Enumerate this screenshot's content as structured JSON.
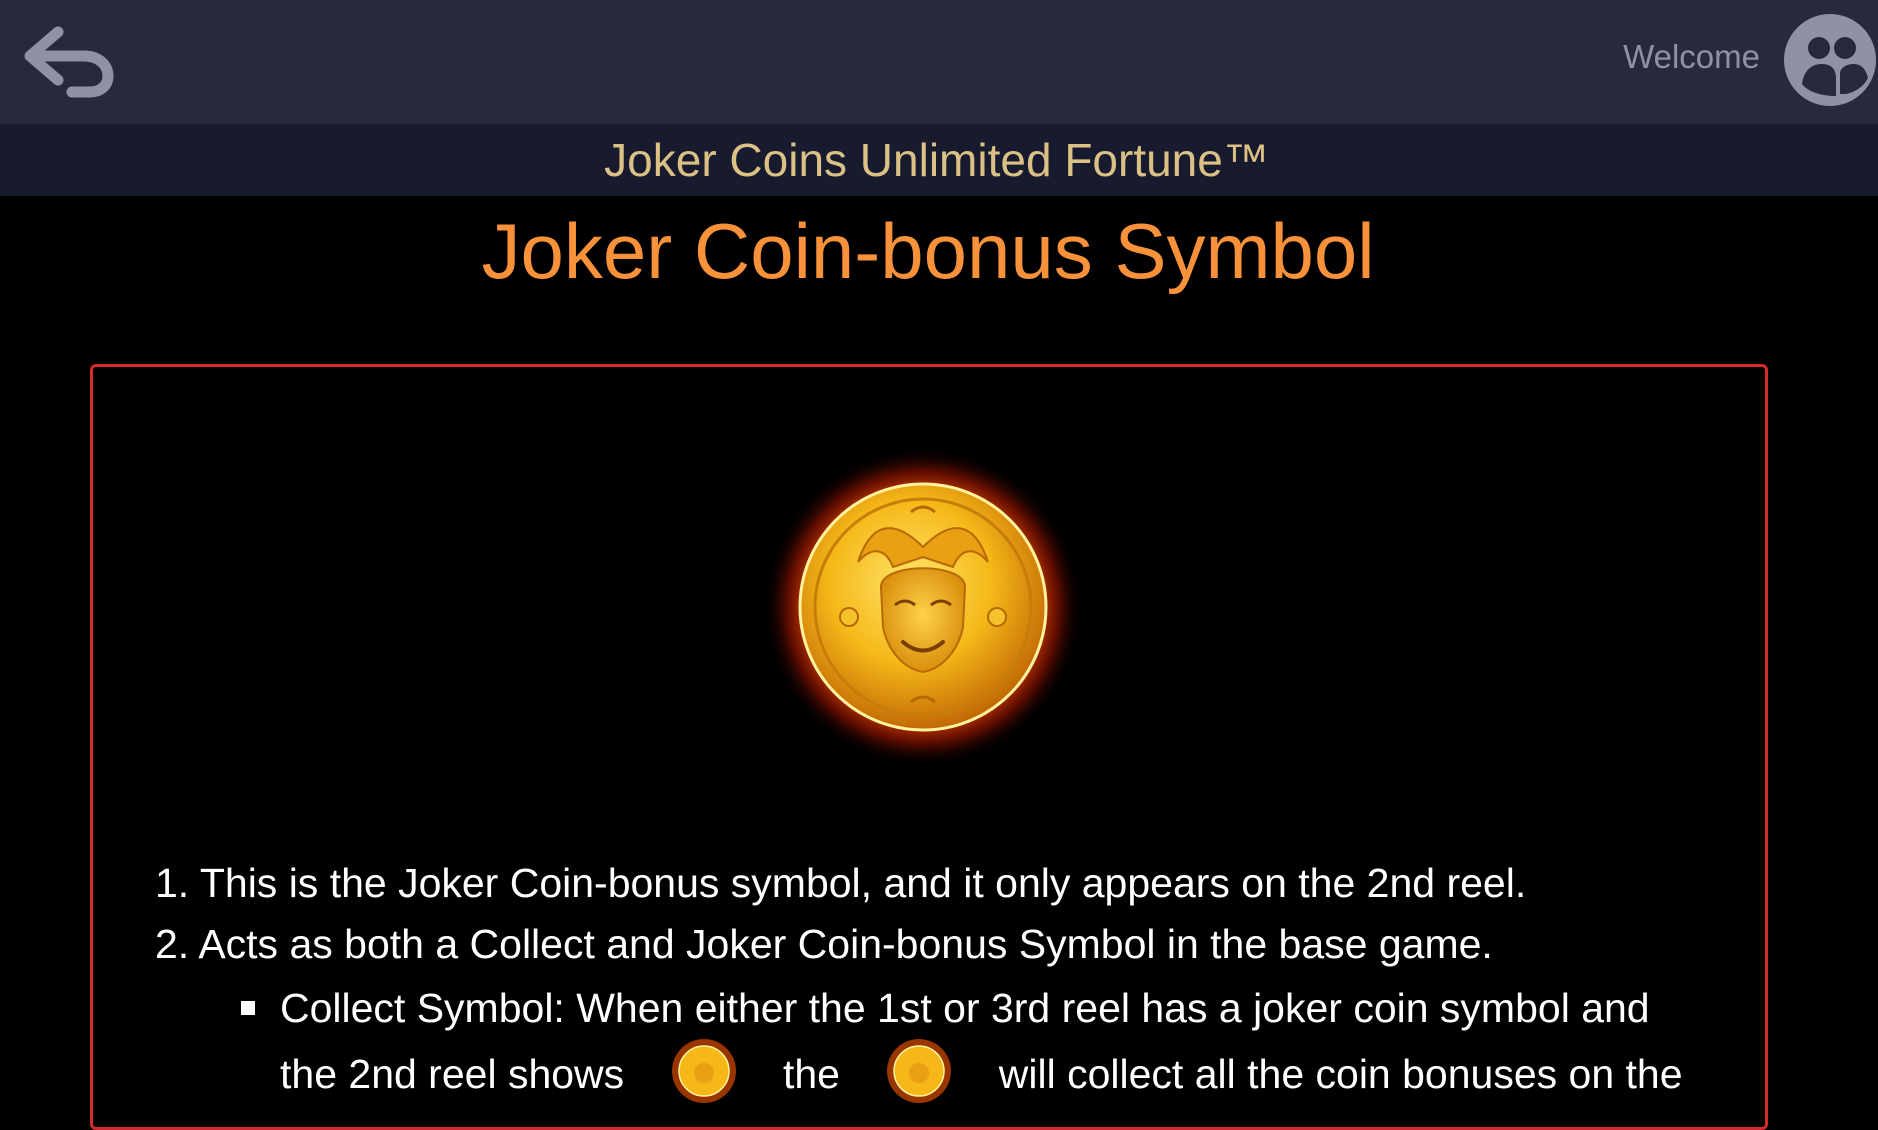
{
  "header": {
    "welcome_text": "Welcome",
    "back_icon": "back-arrow-icon",
    "avatar_icon": "user-avatar-icon"
  },
  "subheader": {
    "game_title": "Joker Coins Unlimited Fortune™"
  },
  "section": {
    "title": "Joker Coin-bonus Symbol"
  },
  "rules": {
    "item1": "1. This is the Joker Coin-bonus symbol, and it only appears on the 2nd reel.",
    "item2": "2. Acts as both a Collect and Joker Coin-bonus Symbol in the base game.",
    "sub1_line1": "Collect Symbol: When either the 1st or 3rd reel has a joker coin symbol and",
    "sub1_line2_a": "the 2nd reel shows",
    "sub1_line2_b": "the",
    "sub1_line2_c": "will collect all the coin bonuses on the"
  },
  "colors": {
    "topbar": "#262a3c",
    "subbar": "#171b2d",
    "title_gold": "#dcc186",
    "section_orange": "#f7913a",
    "panel_border": "#d42a2a"
  }
}
